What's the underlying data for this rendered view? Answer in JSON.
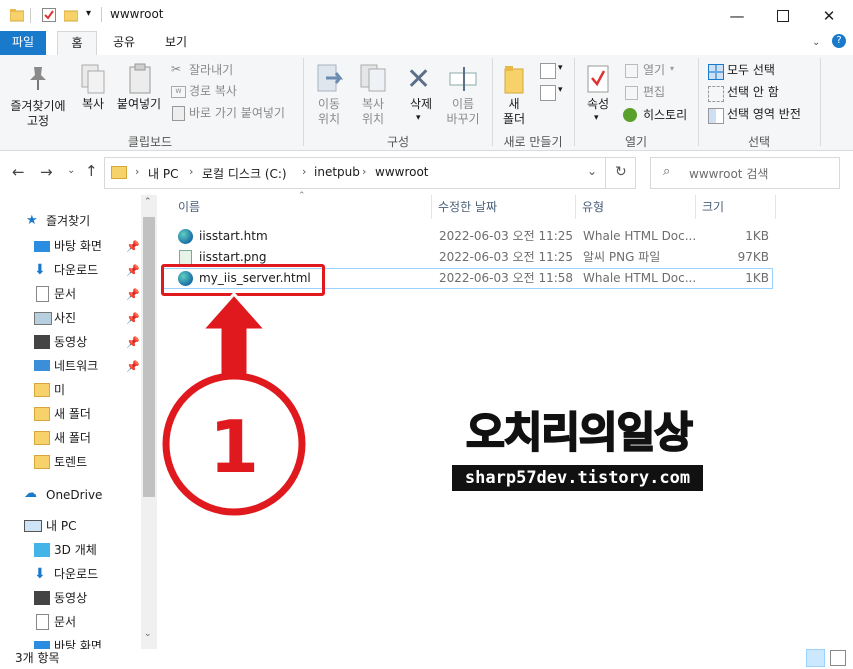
{
  "window": {
    "title": "wwwroot",
    "minimize_icon": "minimize-icon",
    "maximize_icon": "maximize-icon",
    "close_icon": "close-icon"
  },
  "ribbon_tabs": [
    {
      "label": "파일",
      "state": "file"
    },
    {
      "label": "홈",
      "state": "active"
    },
    {
      "label": "공유",
      "state": "normal"
    },
    {
      "label": "보기",
      "state": "normal"
    }
  ],
  "ribbon": {
    "clipboard": {
      "pin_label": "즐겨찾기에\n고정",
      "copy_label": "복사",
      "paste_label": "붙여넣기",
      "cut_label": "잘라내기",
      "copy_path_label": "경로 복사",
      "paste_shortcut_label": "바로 가기 붙여넣기",
      "group_label": "클립보드"
    },
    "organize": {
      "move_label": "이동\n위치",
      "copy_to_label": "복사\n위치",
      "delete_label": "삭제",
      "rename_label": "이름\n바꾸기",
      "group_label": "구성"
    },
    "new": {
      "new_folder_label": "새\n폴더",
      "group_label": "새로 만들기"
    },
    "open": {
      "properties_label": "속성",
      "open_label": "열기",
      "edit_label": "편집",
      "history_label": "히스토리",
      "group_label": "열기"
    },
    "select": {
      "select_all_label": "모두 선택",
      "select_none_label": "선택 안 함",
      "invert_label": "선택 영역 반전",
      "group_label": "선택"
    }
  },
  "address": {
    "path": [
      "내 PC",
      "로컬 디스크 (C:)",
      "inetpub",
      "wwwroot"
    ],
    "search_placeholder": "wwwroot 검색"
  },
  "nav_pane": [
    {
      "label": "즐겨찾기",
      "icon": "star-icon",
      "pinned": false,
      "level": 0
    },
    {
      "label": "바탕 화면",
      "icon": "desktop-icon",
      "pinned": true,
      "level": 1
    },
    {
      "label": "다운로드",
      "icon": "download-icon",
      "pinned": true,
      "level": 1
    },
    {
      "label": "문서",
      "icon": "document-icon",
      "pinned": true,
      "level": 1
    },
    {
      "label": "사진",
      "icon": "picture-icon",
      "pinned": true,
      "level": 1
    },
    {
      "label": "동영상",
      "icon": "video-icon",
      "pinned": true,
      "level": 1
    },
    {
      "label": "네트워크",
      "icon": "network-icon",
      "pinned": true,
      "level": 1
    },
    {
      "label": "미",
      "icon": "folder-icon",
      "pinned": false,
      "level": 1
    },
    {
      "label": "새 폴더",
      "icon": "folder-icon",
      "pinned": false,
      "level": 1
    },
    {
      "label": "새 폴더",
      "icon": "folder-icon",
      "pinned": false,
      "level": 1
    },
    {
      "label": "토렌트",
      "icon": "folder-icon",
      "pinned": false,
      "level": 1
    },
    {
      "label": "OneDrive",
      "icon": "cloud-icon",
      "pinned": false,
      "level": 0
    },
    {
      "label": "내 PC",
      "icon": "pc-icon",
      "pinned": false,
      "level": 0
    },
    {
      "label": "3D 개체",
      "icon": "cube-icon",
      "pinned": false,
      "level": 1
    },
    {
      "label": "다운로드",
      "icon": "download-icon",
      "pinned": false,
      "level": 1
    },
    {
      "label": "동영상",
      "icon": "video-icon",
      "pinned": false,
      "level": 1
    },
    {
      "label": "문서",
      "icon": "document-icon",
      "pinned": false,
      "level": 1
    },
    {
      "label": "바탕 화면",
      "icon": "desktop-icon",
      "pinned": false,
      "level": 1
    }
  ],
  "columns": [
    "이름",
    "수정한 날짜",
    "유형",
    "크기"
  ],
  "files": [
    {
      "name": "iisstart.htm",
      "date": "2022-06-03 오전 11:25",
      "type": "Whale HTML Doc...",
      "size": "1KB",
      "icon": "whale-html-icon"
    },
    {
      "name": "iisstart.png",
      "date": "2022-06-03 오전 11:25",
      "type": "알씨 PNG 파일",
      "size": "97KB",
      "icon": "png-image-icon"
    },
    {
      "name": "my_iis_server.html",
      "date": "2022-06-03 오전 11:58",
      "type": "Whale HTML Doc...",
      "size": "1KB",
      "icon": "whale-html-icon"
    }
  ],
  "annotation": {
    "number": "1",
    "color": "#e0191e"
  },
  "watermark": {
    "title": "오치리의일상",
    "url": "sharp57dev.tistory.com"
  },
  "status": {
    "item_count": "3개 항목"
  },
  "colors": {
    "accent": "#1979ca",
    "annotation_red": "#e0191e",
    "folder_yellow": "#f7d26a"
  }
}
